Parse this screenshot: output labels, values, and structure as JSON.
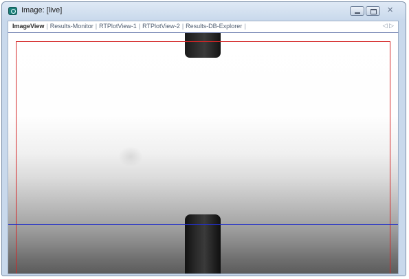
{
  "window": {
    "title": "Image: [live]",
    "icon": "camera-icon"
  },
  "tabs": [
    {
      "label": "ImageView",
      "active": true
    },
    {
      "label": "Results-Monitor",
      "active": false
    },
    {
      "label": "RTPlotView-1",
      "active": false
    },
    {
      "label": "RTPlotView-2",
      "active": false
    },
    {
      "label": "Results-DB-Explorer",
      "active": false
    }
  ],
  "tab_nav": {
    "prev": "◁",
    "next": "▷"
  },
  "overlay_colors": {
    "roi": "#d42626",
    "measurement_line": "#2330c8"
  }
}
